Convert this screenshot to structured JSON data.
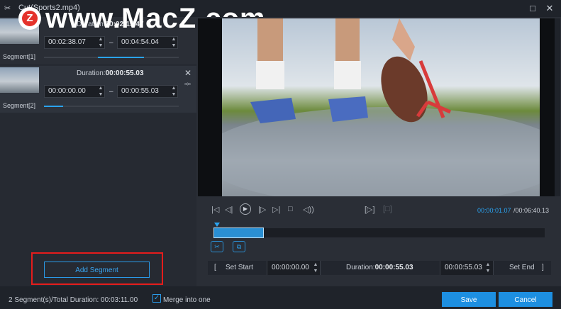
{
  "title_bar": {
    "title": "Cut(Sports2.mp4)",
    "maximize_glyph": "□",
    "close_glyph": "✕"
  },
  "watermark": {
    "text": "www.MacZ.com",
    "badge_letter": "Z"
  },
  "segments": [
    {
      "label": "Segment[1]",
      "duration_label": "Duration:",
      "duration_value": "00:02:15.47",
      "start": "00:02:38.07",
      "end": "00:04:54.04",
      "progress_start": 0.4,
      "progress_end": 0.74
    },
    {
      "label": "Segment[2]",
      "duration_label": "Duration:",
      "duration_value": "00:00:55.03",
      "start": "00:00:00.00",
      "end": "00:00:55.03",
      "progress_start": 0.0,
      "progress_end": 0.14
    }
  ],
  "left_panel": {
    "add_segment": "Add Segment"
  },
  "playback": {
    "current_time": "00:00:01.07",
    "total_time": "/00:06:40.13"
  },
  "range_bar": {
    "set_start": "Set Start",
    "start_value": "00:00:00.00",
    "duration_label": "Duration:",
    "duration_value": "00:00:55.03",
    "end_value": "00:00:55.03",
    "set_end": "Set End",
    "open_bracket": "[",
    "close_bracket": "]"
  },
  "footer": {
    "status": "2 Segment(s)/Total Duration: 00:03:11.00",
    "merge_label": "Merge into one",
    "merge_checked": true,
    "save": "Save",
    "cancel": "Cancel"
  },
  "colors": {
    "accent": "#1d8fe1",
    "highlight": "#e51c1c"
  },
  "icons": [
    "scissors-icon",
    "skip-start-icon",
    "frame-back-icon",
    "play-icon",
    "frame-forward-icon",
    "skip-end-icon",
    "stop-icon",
    "volume-icon",
    "mark-in-icon",
    "mark-out-icon",
    "cut-icon",
    "copy-icon"
  ]
}
